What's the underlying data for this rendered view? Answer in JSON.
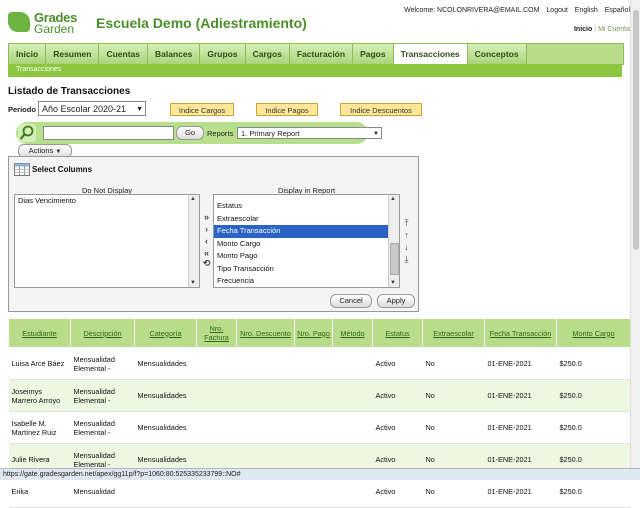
{
  "header": {
    "logo_line1": "Grades",
    "logo_line2": "Garden",
    "school_title": "Escuela Demo (Adiestramiento)",
    "welcome": "Welcome: NCOLONRIVERA@EMAIL.COM",
    "logout": "Logout",
    "english": "English",
    "espanol": "Español",
    "inicio": "Inicio",
    "mi_cuenta": "Mi Cuenta"
  },
  "nav": {
    "tabs": [
      "Inicio",
      "Resumen",
      "Cuentas",
      "Balances",
      "Grupos",
      "Cargos",
      "Facturación",
      "Pagos",
      "Transacciones",
      "Conceptos"
    ],
    "active": "Transacciones",
    "sub": "Transacciones"
  },
  "page": {
    "title": "Listado de Transacciones",
    "periodo_label": "Periodo",
    "periodo_value": "Año Escolar 2020-21",
    "btn_cargos": "Indice Cargos",
    "btn_pagos": "Indice Pagos",
    "btn_descuentos": "Indice Descuentos"
  },
  "search": {
    "value": "",
    "go": "Go",
    "reports_label": "Reports",
    "report_value": "1. Primary Report",
    "actions": "Actions"
  },
  "columns": {
    "title": "Select Columns",
    "do_not_display_label": "Do Not Display",
    "display_label": "Display in Report",
    "do_not_display": [
      "Dias Vencimiento"
    ],
    "display": [
      "Estatus",
      "Extraescolar",
      "Fecha Transacción",
      "Monto Cargo",
      "Monto Pago",
      "Tipo Transacción",
      "Frecuencia"
    ],
    "display_selected": "Fecha Transacción",
    "cancel": "Cancel",
    "apply": "Apply"
  },
  "table": {
    "headers": [
      "Estudiante",
      "Descripción",
      "Categoría",
      "Nro. Factura",
      "Nro. Descuento",
      "Nro. Pago",
      "Método",
      "Estatus",
      "Extraescolar",
      "Fecha Transacción",
      "Monto Cargo"
    ],
    "rows": [
      [
        "Luisa Arce Báez",
        "Mensualidad Elemental -",
        "Mensualidades",
        "",
        "",
        "",
        "",
        "Activo",
        "No",
        "01-ENE-2021",
        "$250.0"
      ],
      [
        "Joseimys Marrero Arroyo",
        "Mensualidad Elemental -",
        "Mensualidades",
        "",
        "",
        "",
        "",
        "Activo",
        "No",
        "01-ENE-2021",
        "$250.0"
      ],
      [
        "Isabelle M. Martínez Ruiz",
        "Mensualidad Elemental -",
        "Mensualidades",
        "",
        "",
        "",
        "",
        "Activo",
        "No",
        "01-ENE-2021",
        "$250.0"
      ],
      [
        "Julie Rivera",
        "Mensualidad Elemental -",
        "Mensualidades",
        "",
        "",
        "",
        "",
        "Activo",
        "No",
        "01-ENE-2021",
        "$250.0"
      ],
      [
        "Erika",
        "Mensualidad",
        "",
        "",
        "",
        "",
        "",
        "Activo",
        "No",
        "01-ENE-2021",
        "$250.0"
      ]
    ]
  },
  "status_url": "https://gate.gradesgarden.net/apex/gg11p/f?p=1060:80:525335233799::NO#"
}
